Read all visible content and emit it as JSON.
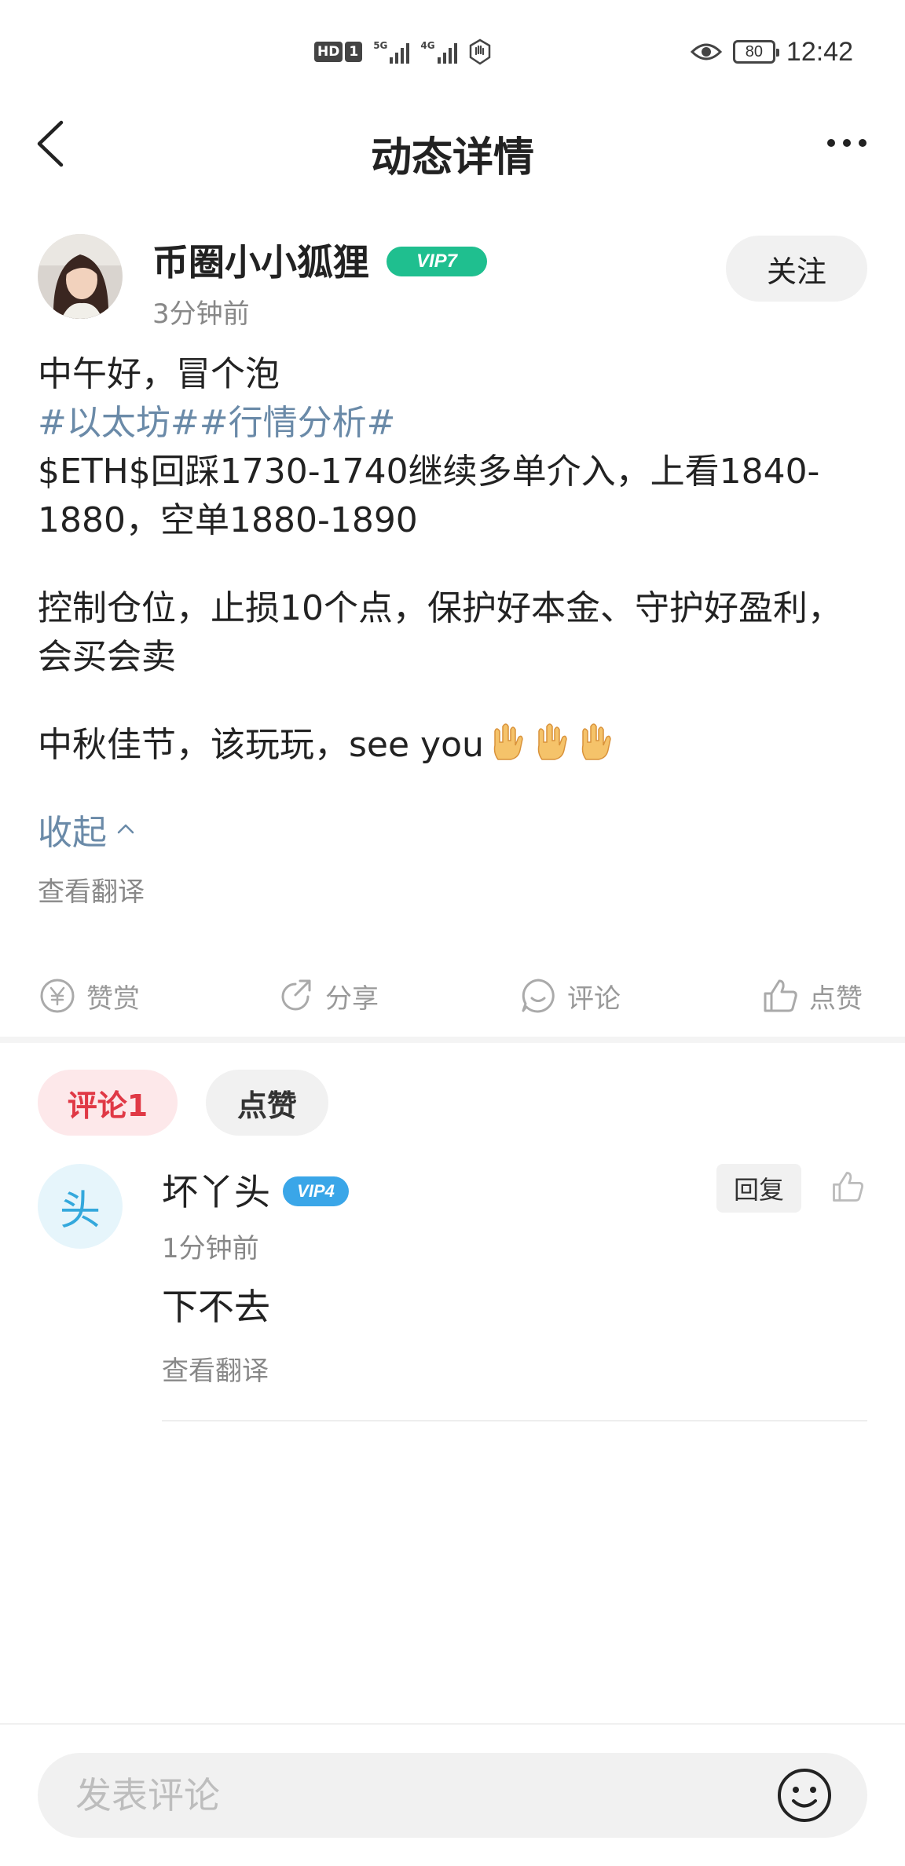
{
  "status_bar": {
    "hd_label": "HD",
    "sim_label": "1",
    "network_1": "5G",
    "network_2": "4G",
    "battery": "80",
    "time": "12:42"
  },
  "nav": {
    "title": "动态详情"
  },
  "author": {
    "name": "币圈小小狐狸",
    "vip": "VIP7",
    "time": "3分钟前",
    "follow_label": "关注"
  },
  "post": {
    "line1": "中午好，冒个泡",
    "topics": "#以太坊##行情分析#",
    "line3": "$ETH$回踩1730-1740继续多单介入，上看1840-1880，空单1880-1890",
    "line4": "控制仓位，止损10个点，保护好本金、守护好盈利，会买会卖",
    "line5": "中秋佳节，该玩玩，see you",
    "collapse_label": "收起",
    "translate_label": "查看翻译"
  },
  "actions": {
    "reward": "赞赏",
    "share": "分享",
    "comment": "评论",
    "like": "点赞"
  },
  "tabs": {
    "comments": "评论1",
    "likes": "点赞"
  },
  "comment": {
    "avatar_text": "头",
    "name": "坏丫头",
    "vip": "VIP4",
    "time": "1分钟前",
    "reply_label": "回复",
    "text": "下不去",
    "translate_label": "查看翻译"
  },
  "input": {
    "placeholder": "发表评论"
  },
  "colors": {
    "accent_red": "#e03845",
    "topic_blue": "#6a8aa8",
    "vip7_green": "#1fbf8f",
    "vip4_blue": "#3aa6e8"
  }
}
